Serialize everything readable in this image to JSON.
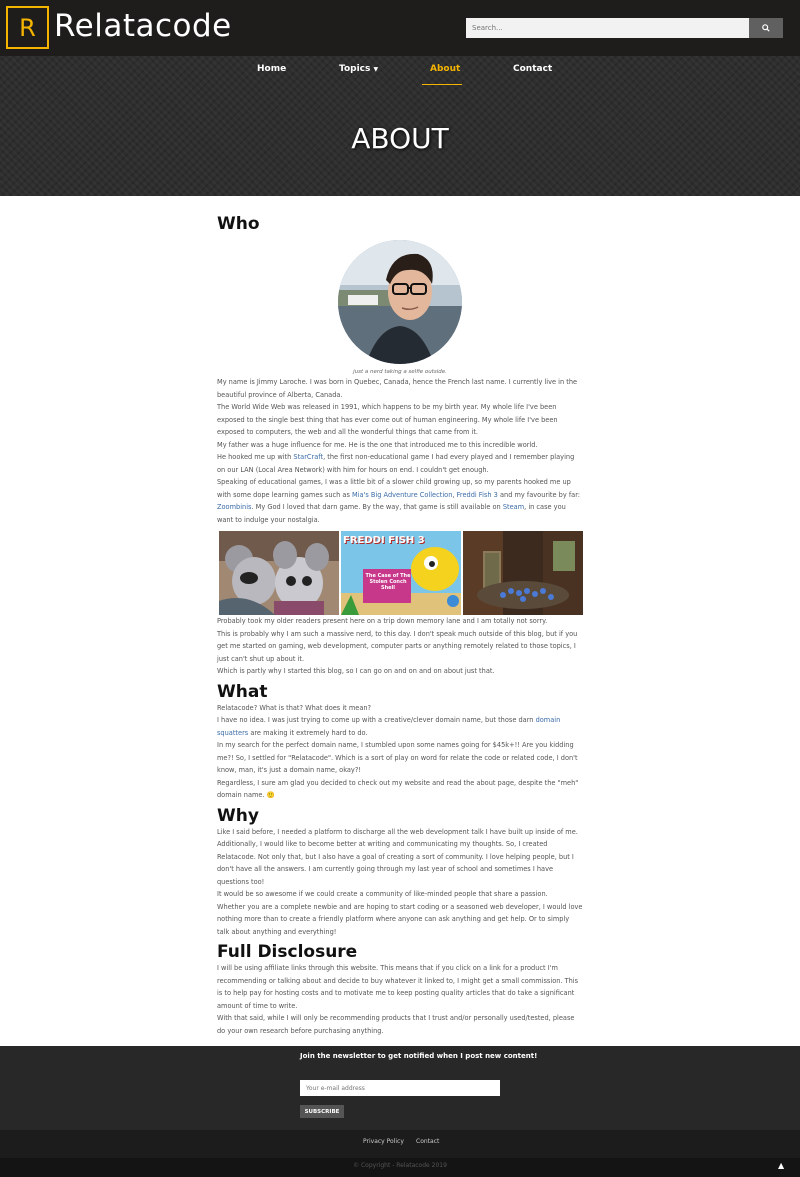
{
  "header": {
    "logo_letter": "R",
    "site_name": "Relatacode",
    "search_placeholder": "Search...",
    "search_icon": "magnifier-icon"
  },
  "nav": {
    "items": [
      {
        "label": "Home"
      },
      {
        "label": "Topics",
        "has_dropdown": true
      },
      {
        "label": "About",
        "active": true
      },
      {
        "label": "Contact"
      }
    ]
  },
  "hero": {
    "title": "ABOUT"
  },
  "colors": {
    "accent": "#f4b400",
    "link": "#3b6ca8",
    "header_bg": "#1f1c1c",
    "footer_bg": "#282828"
  },
  "sections": {
    "who": {
      "heading": "Who",
      "caption": "just a nerd taking a selfie outside.",
      "p1": "My name is Jimmy Laroche. I was born in Quebec, Canada, hence the French last name. I currently live in the beautiful province of Alberta, Canada.",
      "p2": "The World Wide Web was released in 1991, which happens to be my birth year. My whole life I've been exposed to the single best thing that has ever come out of human engineering. My whole life I've been exposed to computers, the web and all the wonderful things that came from it.",
      "p3": "My father was a huge influence for me. He is the one that introduced me to this incredible world.",
      "p4a": "He hooked me up with ",
      "p4_link": "StarCraft",
      "p4b": ", the first non-educational game I had every played and I remember playing on our LAN (Local Area Network) with him for hours on end. I couldn't get enough.",
      "p5a": "Speaking of educational games, I was a little bit of a slower child growing up, so my parents hooked me up with some dope learning games such as ",
      "p5_link1": "Mia's Big Adventure Collection",
      "p5_sep": ", ",
      "p5_link2": "Freddi Fish 3",
      "p5b": " and my favourite by far: ",
      "p5_link3": "Zoombinis",
      "p5c": ". My God I loved that darn game. By the way, that game is still available on ",
      "p5_link4": "Steam",
      "p5d": ", in case you want to indulge your nostalgia.",
      "p6": "Probably took my older readers present here on a trip down memory lane and I am totally not sorry.",
      "p7": "This is probably why I am such a massive nerd, to this day. I don't speak much outside of this blog, but if you get me started on gaming, web development, computer parts or anything remotely related to those topics, I just can't shut up about it.",
      "p8": "Which is partly why I started this blog, so I can go on and on and on about just that.",
      "game2_title": "FREDDI FISH 3",
      "game2_subtitle": "The Case of The Stolen Conch Shell"
    },
    "what": {
      "heading": "What",
      "p1": "Relatacode? What is that? What does it mean?",
      "p2a": "I have no idea. I was just trying to come up with a creative/clever domain name, but those darn ",
      "p2_link": "domain squatters",
      "p2b": " are making it extremely hard to do.",
      "p3": "In my search for the perfect domain name, I stumbled upon some names going for $45k+!! Are you kidding me?! So, I settled for \"Relatacode\". Which is a sort of play on word for relate the code or related code, I don't know, man, it's just a domain name, okay?!",
      "p4": "Regardless, I sure am glad you decided to check out my website and read the about page, despite the \"meh\" domain name. 🙂"
    },
    "why": {
      "heading": "Why",
      "p1": "Like I said before, I needed a platform to discharge all the web development talk I have built up inside of me. Additionally, I would like to become better at writing and communicating my thoughts. So, I created Relatacode. Not only that, but I also have a goal of creating a sort of community. I love helping people, but I don't have all the answers. I am currently going through my last year of school and sometimes I have questions too!",
      "p2": "It would be so awesome if we could create a community of like-minded people that share a passion.",
      "p3": "Whether you are a complete newbie and are hoping to start coding or a seasoned web developer, I would love nothing more than to create a friendly platform where anyone can ask anything and get help. Or to simply talk about anything and everything!"
    },
    "disclosure": {
      "heading": "Full Disclosure",
      "p1": "I will be using affiliate links through this website. This means that if you click on a link for a product I'm recommending or talking about and decide to buy whatever it linked to, I might get a small commission. This is to help pay for hosting costs and to motivate me to keep posting quality articles that do take a significant amount of time to write.",
      "p2": "With that said, while I will only be recommending products that I trust and/or personally used/tested, please do your own research before purchasing anything."
    }
  },
  "newsletter": {
    "title": "Join the newsletter to get notified when I post new content!",
    "email_placeholder": "Your e-mail address",
    "button_label": "SUBSCRIBE"
  },
  "footer": {
    "links": [
      "Privacy Policy",
      "Contact"
    ],
    "copyright": "© Copyright - Relatacode 2019",
    "to_top_icon": "chevron-up-icon"
  }
}
